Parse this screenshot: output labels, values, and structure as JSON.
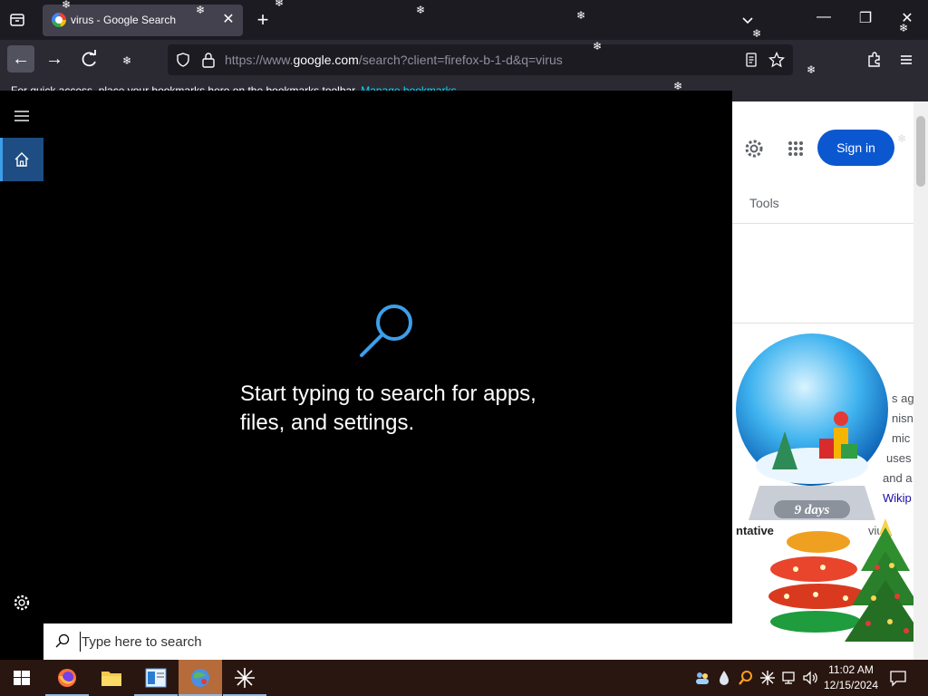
{
  "browser": {
    "tab": {
      "title": "virus - Google Search",
      "close_glyph": "✕"
    },
    "new_tab_glyph": "+",
    "window_controls": {
      "minimize": "—",
      "restore": "❐",
      "close": "✕"
    },
    "nav": {
      "back_glyph": "←",
      "forward_glyph": "→"
    },
    "url": {
      "prefix": "https://www.",
      "host": "google.com",
      "path": "/search?client=firefox-b-1-d&q=virus"
    },
    "bookmarks_bar": {
      "text": "For quick access, place your bookmarks here on the bookmarks toolbar.",
      "link": "Manage bookmarks"
    }
  },
  "google_page": {
    "signin_label": "Sign in",
    "tools_label": "Tools",
    "fragments": [
      "s ag",
      "nisn",
      "mic",
      "uses",
      "and a",
      "ntative",
      "vius,",
      "Wikip"
    ],
    "overlay_label": "9 days"
  },
  "windows_search": {
    "hint": "Start typing to search for apps, files, and settings.",
    "input_placeholder": "Type here to search",
    "accent_color": "#3d9ee9"
  },
  "taskbar": {
    "apps": [
      "Firefox",
      "File Explorer",
      "Sticky Notes",
      "Desktop Christmas app",
      "Sparkle app"
    ],
    "clock": {
      "time": "11:02 AM",
      "date": "12/15/2024"
    }
  }
}
